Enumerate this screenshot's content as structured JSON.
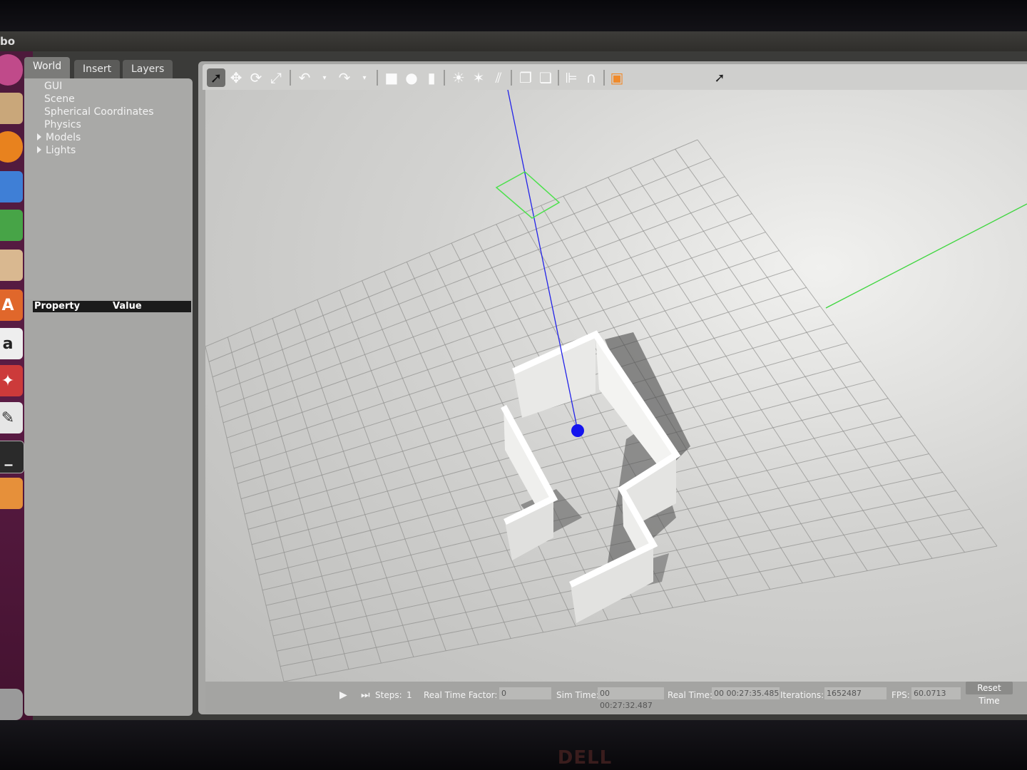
{
  "window": {
    "title_fragment": "bo"
  },
  "monitor": {
    "brand": "DELL"
  },
  "launcher": {
    "icons": [
      "ubuntu-icon",
      "files-icon",
      "firefox-icon",
      "writer-icon",
      "calc-icon",
      "impress-icon",
      "software-center-icon",
      "amazon-icon",
      "settings-icon",
      "text-editor-icon",
      "terminal-icon",
      "gazebo-icon",
      "trash-icon"
    ]
  },
  "left_panel": {
    "tabs": [
      {
        "label": "World",
        "active": true
      },
      {
        "label": "Insert",
        "active": false
      },
      {
        "label": "Layers",
        "active": false
      }
    ],
    "tree": [
      {
        "label": "GUI",
        "expandable": false
      },
      {
        "label": "Scene",
        "expandable": false
      },
      {
        "label": "Spherical Coordinates",
        "expandable": false
      },
      {
        "label": "Physics",
        "expandable": false
      },
      {
        "label": "Models",
        "expandable": true
      },
      {
        "label": "Lights",
        "expandable": true
      }
    ],
    "properties": {
      "col_property": "Property",
      "col_value": "Value"
    }
  },
  "toolbar": {
    "tools": [
      "select-mode-icon",
      "translate-mode-icon",
      "rotate-mode-icon",
      "scale-mode-icon",
      "undo-icon",
      "redo-icon",
      "box-icon",
      "sphere-icon",
      "cylinder-icon",
      "point-light-icon",
      "spot-light-icon",
      "directional-light-icon",
      "copy-icon",
      "paste-icon",
      "align-icon",
      "snap-icon",
      "view-angle-icon"
    ],
    "active_tool": "select-mode-icon"
  },
  "scene": {
    "colors": {
      "z_axis": "#2323e8",
      "y_axis": "#3fd63f",
      "selection": "#4de04d",
      "robot": "#1414ee",
      "wall": "#f6f6f6",
      "wall_shadow": "#4a4a4a",
      "grid": "#8f8f8d"
    }
  },
  "statusbar": {
    "steps_label": "Steps:",
    "steps_value": "1",
    "rtf_label": "Real Time Factor:",
    "rtf_value": "0",
    "sim_time_label": "Sim Time:",
    "sim_time_value": "00 00:27:32.487",
    "real_time_label": "Real Time:",
    "real_time_value": "00 00:27:35.485",
    "iterations_label": "Iterations:",
    "iterations_value": "1652487",
    "fps_label": "FPS:",
    "fps_value": "60.0713",
    "reset_label": "Reset Time"
  }
}
